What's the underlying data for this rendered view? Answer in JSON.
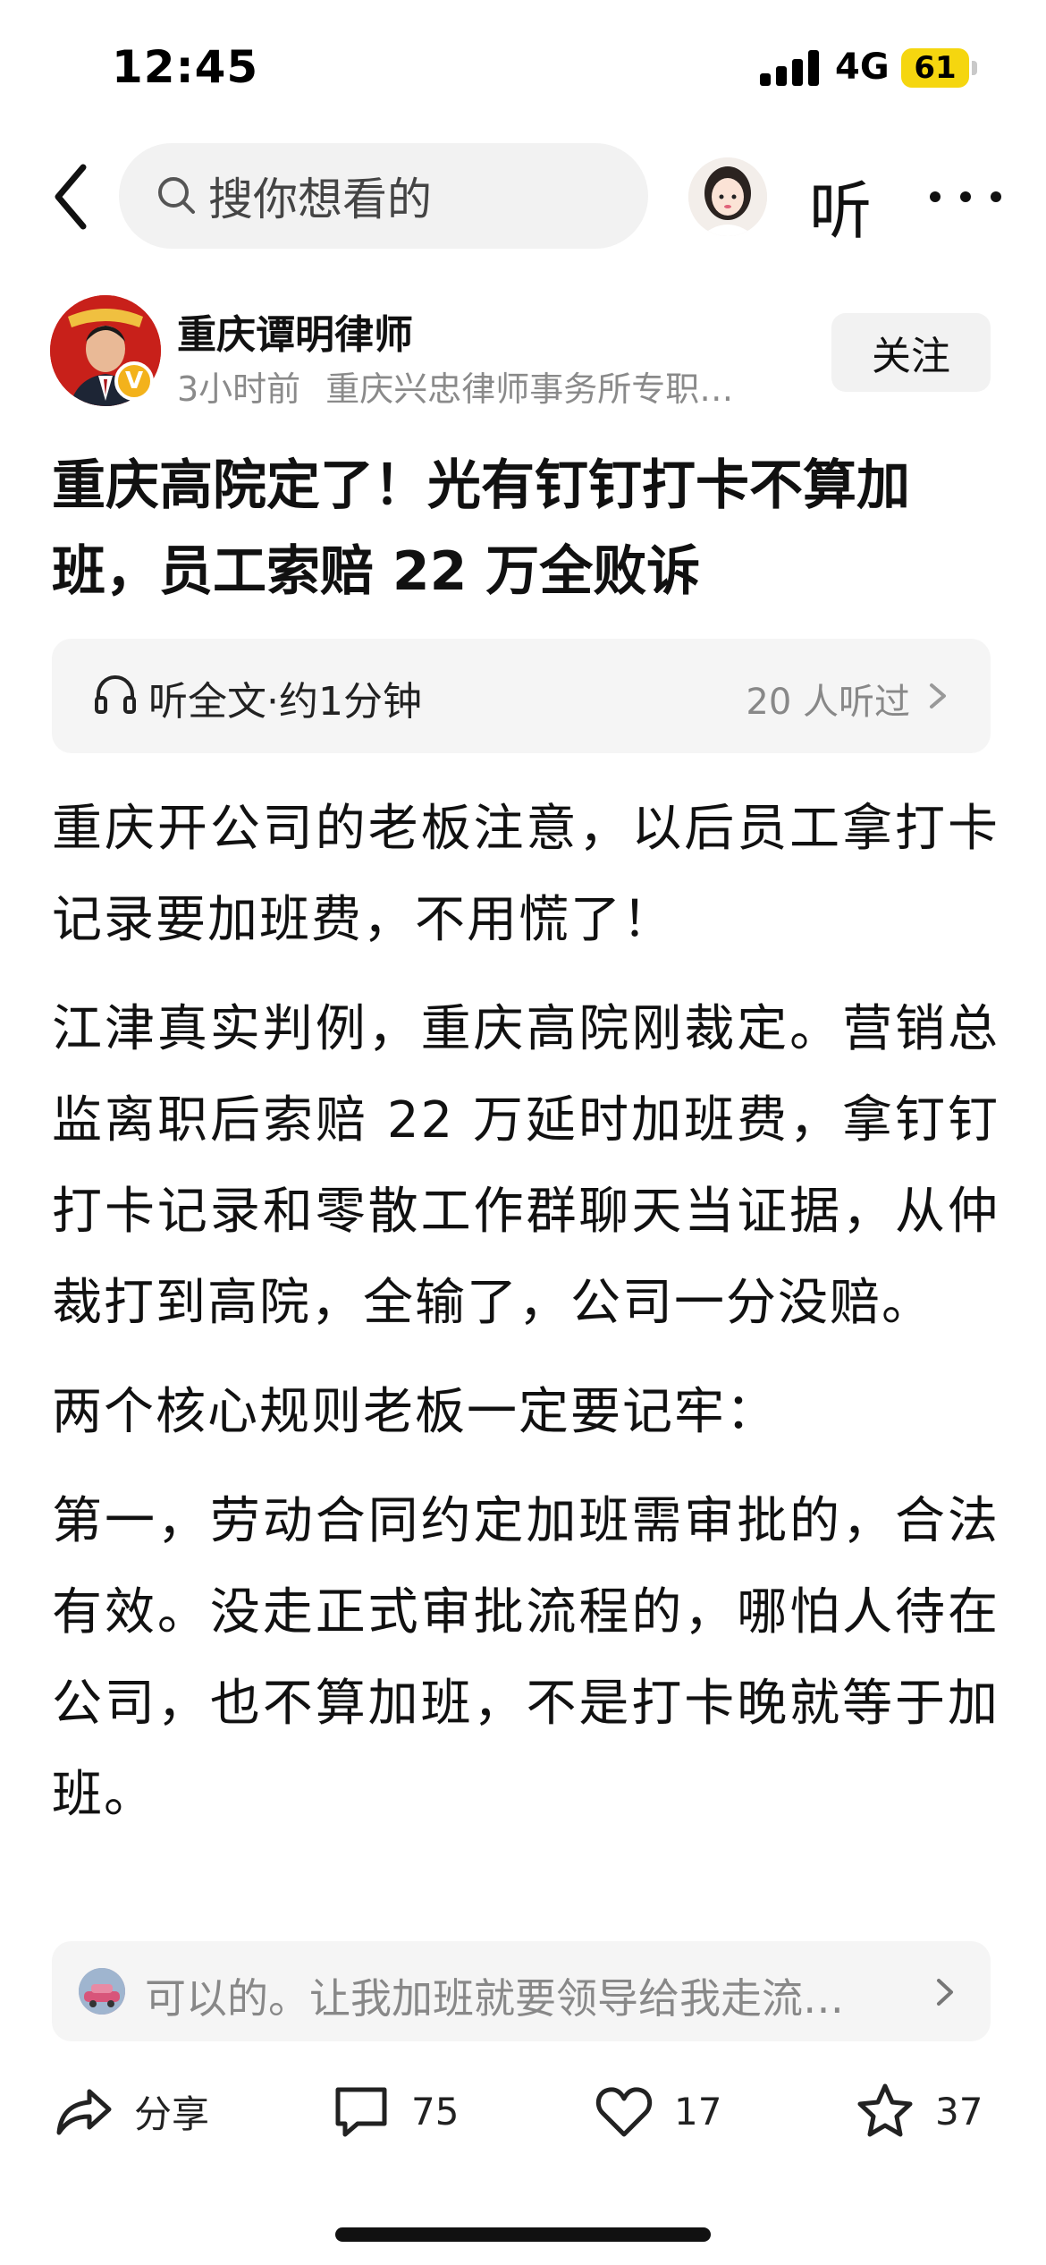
{
  "status_bar": {
    "time": "12:45",
    "network": "4G",
    "battery_level": "61",
    "battery_color": "#f5d60f"
  },
  "nav": {
    "search_placeholder": "搜你想看的",
    "listen_label": "听"
  },
  "author": {
    "name": "重庆谭明律师",
    "time_ago": "3小时前",
    "description": "重庆兴忠律师事务所专职…",
    "verify_badge": "V",
    "follow_label": "关注"
  },
  "article": {
    "title": "重庆高院定了！光有钉钉打卡不算加班，员工索赔 22 万全败诉",
    "listen_bar": {
      "label": "听全文·约1分钟",
      "count": "20 人听过"
    },
    "paragraphs": [
      "重庆开公司的老板注意，以后员工拿打卡记录要加班费，不用慌了！",
      "江津真实判例，重庆高院刚裁定。营销总监离职后索赔  22  万延时加班费，拿钉钉打卡记录和零散工作群聊天当证据，从仲裁打到高院，全输了，公司一分没赔。",
      "两个核心规则老板一定要记牢：",
      "第一，劳动合同约定加班需审批的，合法有效。没走正式审批流程的，哪怕人待在公司，也不算加班，不是打卡晚就等于加班。"
    ]
  },
  "comment_preview": {
    "text": "可以的。让我加班就要领导给我走流…"
  },
  "actions": {
    "share_label": "分享",
    "comment_count": "75",
    "like_count": "17",
    "favorite_count": "37"
  },
  "colors": {
    "accent_red": "#c8201a",
    "badge_gold": "#f3b21b",
    "muted_text": "#888888",
    "pill_background": "#f5f5f5"
  }
}
